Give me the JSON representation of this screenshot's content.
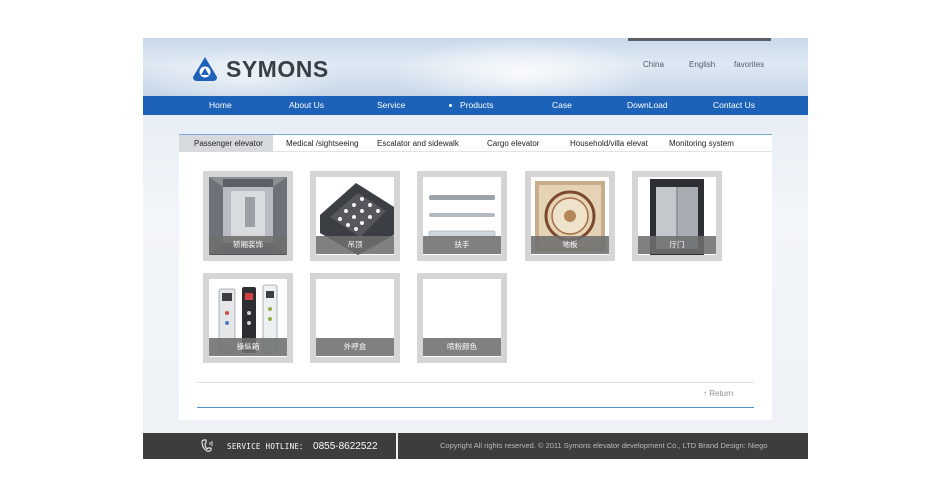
{
  "brand": {
    "name": "SYMONS",
    "logo_color": "#1c62b8"
  },
  "languages": [
    "China",
    "English",
    "favorites"
  ],
  "nav": {
    "items": [
      {
        "label": "Home"
      },
      {
        "label": "About Us"
      },
      {
        "label": "Service"
      },
      {
        "label": "Products",
        "active": true
      },
      {
        "label": "Case"
      },
      {
        "label": "DownLoad"
      },
      {
        "label": "Contact Us"
      }
    ]
  },
  "tabs": [
    {
      "label": "Passenger elevator",
      "active": true
    },
    {
      "label": "Medical /sightseeing"
    },
    {
      "label": "Escalator and sidewalk"
    },
    {
      "label": "Cargo elevator"
    },
    {
      "label": "Household/villa elevat"
    },
    {
      "label": "Monitoring system"
    }
  ],
  "products": [
    {
      "caption": "轿厢装饰",
      "icon": "elevator-cabin-image"
    },
    {
      "caption": "吊顶",
      "icon": "ceiling-image"
    },
    {
      "caption": "扶手",
      "icon": "handrail-image"
    },
    {
      "caption": "地板",
      "icon": "floor-image"
    },
    {
      "caption": "厅门",
      "icon": "hall-door-image"
    },
    {
      "caption": "操纵箱",
      "icon": "control-panel-image"
    },
    {
      "caption": "外呼盒",
      "icon": "call-box-image"
    },
    {
      "caption": "喷粉颜色",
      "icon": "powder-color-image"
    }
  ],
  "return_label": "↑ Return",
  "footer": {
    "hotline_label": "SERVICE HOTLINE：",
    "hotline_number": "0855-8622522",
    "copyright": "Copyright All rights reserved. © 2011 Symons elevator development Co., LTD Brand Design: Niego"
  },
  "colors": {
    "nav": "#1c62b8",
    "footer": "#3d3d3d",
    "tab_active": "#d6d9dd"
  }
}
